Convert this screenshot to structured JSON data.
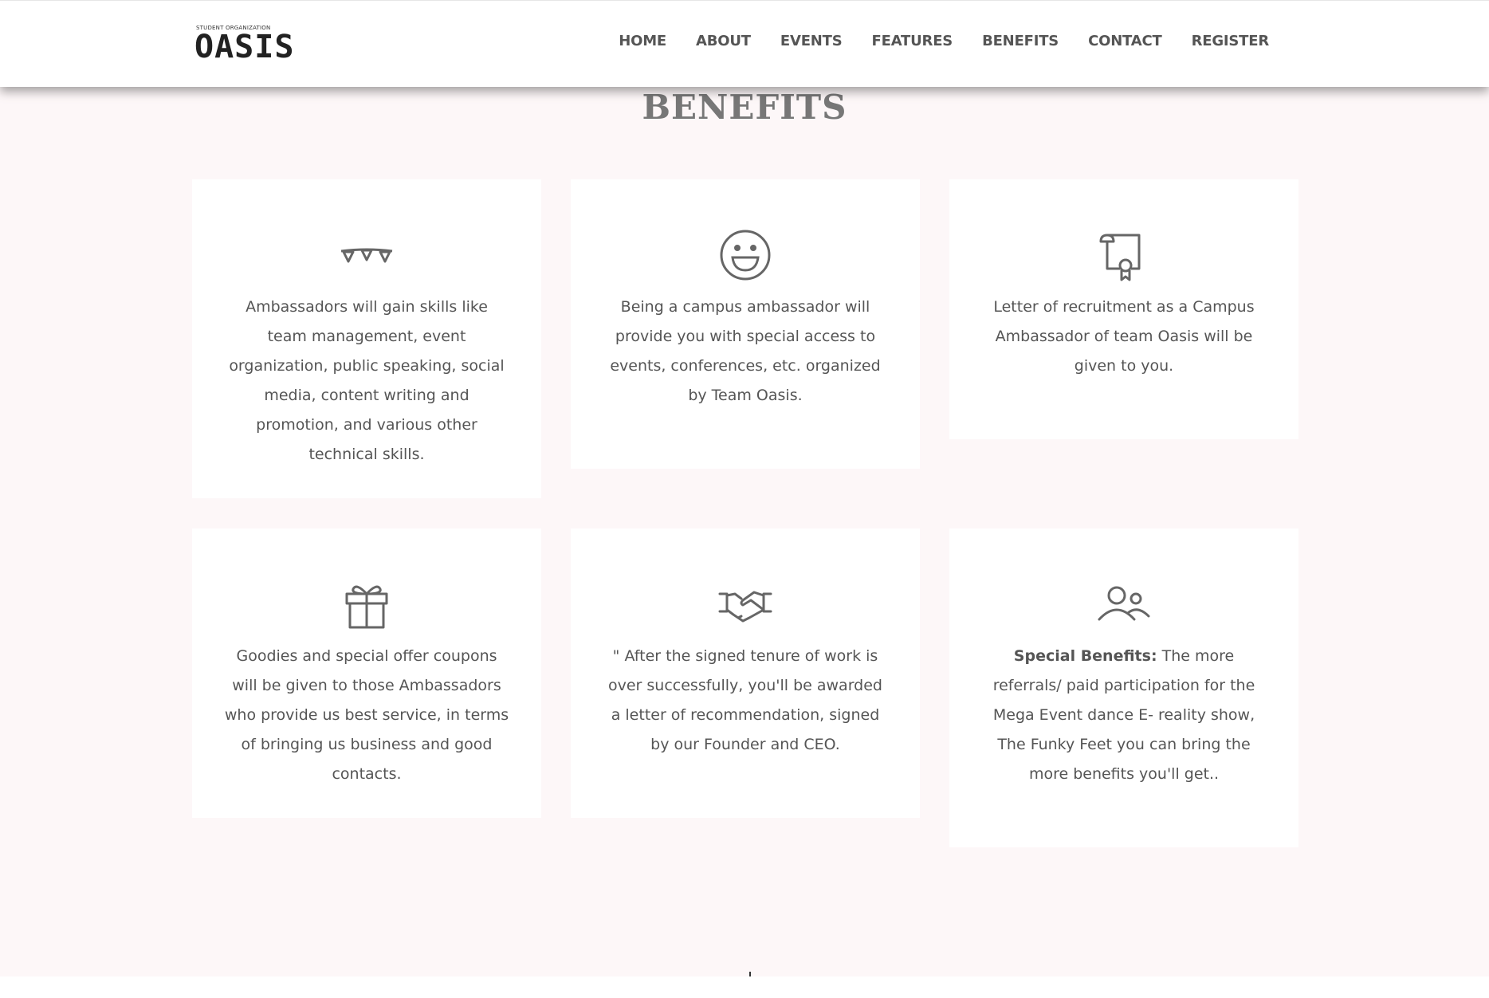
{
  "header": {
    "logo_small": "STUDENT ORGANIZATION",
    "logo_text": "OASIS",
    "nav": [
      "HOME",
      "ABOUT",
      "EVENTS",
      "FEATURES",
      "BENEFITS",
      "CONTACT",
      "REGISTER"
    ]
  },
  "section": {
    "title": "BENEFITS"
  },
  "cards": [
    {
      "icon": "bunting-icon",
      "text": "Ambassadors will gain skills like team management, event organization, public speaking, social media, content writing and promotion, and various other technical skills."
    },
    {
      "icon": "smiley-icon",
      "text": "Being a campus ambassador will provide you with special access to events, conferences, etc. organized by Team Oasis."
    },
    {
      "icon": "certificate-icon",
      "text": "Letter of recruitment as a Campus Ambassador of team Oasis will be given to you."
    },
    {
      "icon": "gift-icon",
      "text": "Goodies and special offer coupons will be given to those Ambassadors who provide us best service, in terms of bringing us business and good contacts."
    },
    {
      "icon": "handshake-icon",
      "text": "\" After the signed tenure of work is over successfully, you'll be awarded a letter of recommendation, signed by our Founder and CEO."
    },
    {
      "icon": "users-icon",
      "bold": "Special Benefits:",
      "text": " The more referrals/ paid participation for the Mega Event dance E- reality show, The Funky Feet you can bring the more benefits you'll get.."
    }
  ],
  "colors": {
    "icon": "#666666",
    "text": "#555555",
    "background": "#fdf7f8",
    "title": "#777777"
  }
}
